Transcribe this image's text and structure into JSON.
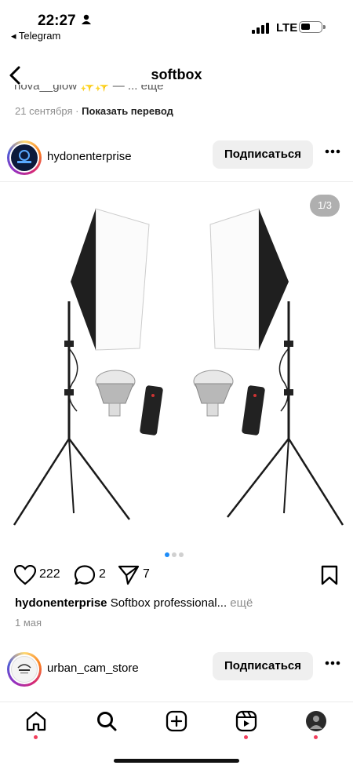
{
  "status_bar": {
    "time": "22:27",
    "back_app": "◂ Telegram",
    "network": "LTE"
  },
  "nav": {
    "title": "softbox"
  },
  "previous_post": {
    "clipped_text": "nova__glow ✨✨ — ... еще",
    "date": "21 сентября",
    "translate": "Показать перевод"
  },
  "post1": {
    "username": "hydonenterprise",
    "follow_label": "Подписаться",
    "counter": "1/3",
    "likes": "222",
    "comments": "2",
    "shares": "7",
    "caption_user": "hydonenterprise",
    "caption_text": "Softbox professional...",
    "caption_more": "ещё",
    "date": "1 мая",
    "carousel_active": 1,
    "carousel_total": 3
  },
  "post2": {
    "username": "urban_cam_store",
    "follow_label": "Подписаться"
  },
  "tab_bar": {
    "items": [
      "home-icon",
      "search-icon",
      "create-icon",
      "reels-icon",
      "profile-avatar"
    ]
  },
  "colors": {
    "accent_blue": "#1d8cf8",
    "notification_red": "#f23e5c",
    "button_gray": "#efefef"
  }
}
